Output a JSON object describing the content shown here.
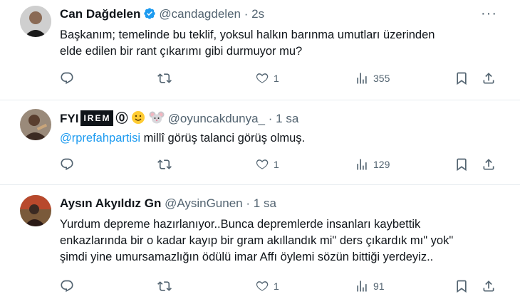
{
  "tweets": [
    {
      "name": "Can Dağdelen",
      "handle": "@candagdelen",
      "separator": "·",
      "time": "2s",
      "verified": true,
      "text_lines": [
        "Başkanım; temelinde bu teklif, yoksul halkın barınma umutları üzerinden",
        "elde edilen bir rant çıkarımı gibi durmuyor mu?"
      ],
      "counts": {
        "reply": "",
        "retweet": "",
        "like": "1",
        "views": "355"
      }
    },
    {
      "name_prefix": "FYI",
      "name_badge": "IREM",
      "name_suffix": "⓪",
      "handle": "@oyuncakdunya_",
      "separator": "·",
      "time": "1 sa",
      "mention": "@rprefahpartisi",
      "text_rest": " millî görüş talanci görüş olmuş.",
      "counts": {
        "reply": "",
        "retweet": "",
        "like": "1",
        "views": "129"
      }
    },
    {
      "name": "Aysın Akyıldız Gn",
      "handle": "@AysinGunen",
      "separator": "·",
      "time": "1 sa",
      "text_lines": [
        "Yurdum depreme hazırlanıyor..Bunca  depremlerde insanları kaybettik",
        "enkazlarında bir o kadar kayıp  bir gram akıllandık mi\" ders çıkardık mı\" yok\"",
        "şimdi yine umursamazlığın ödülü imar Affı öylemi sözün bittiği yerdeyiz.."
      ],
      "counts": {
        "reply": "",
        "retweet": "",
        "like": "1",
        "views": "91"
      }
    }
  ],
  "more_label": "···",
  "colors": {
    "mention": "#1d9bf0",
    "verified": "#1d9bf0",
    "muted": "#536471"
  }
}
